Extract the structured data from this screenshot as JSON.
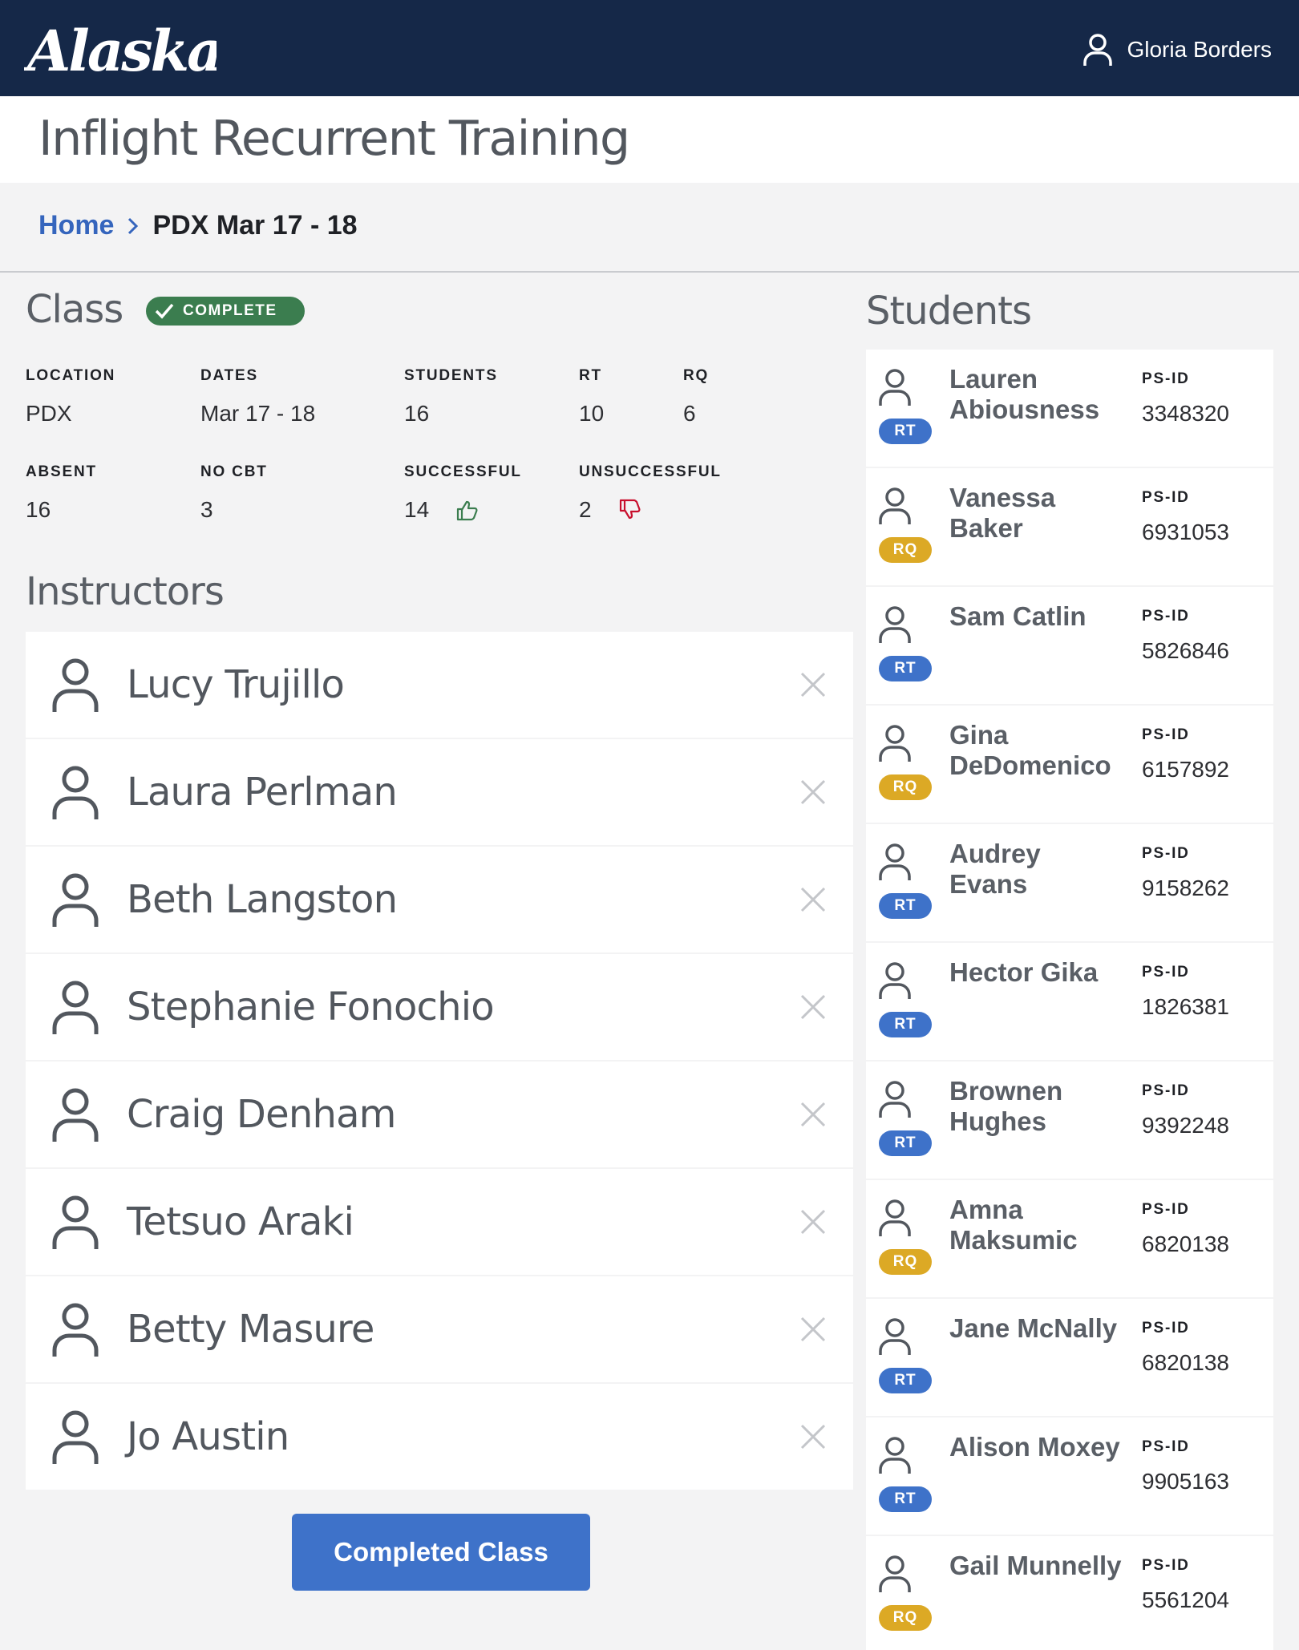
{
  "header": {
    "logo_text": "Alaska",
    "user_name": "Gloria Borders",
    "user_icon": "user-icon"
  },
  "page": {
    "title": "Inflight Recurrent Training"
  },
  "breadcrumb": {
    "home": "Home",
    "separator_icon": "chevron-right-icon",
    "current": "PDX Mar 17 - 18"
  },
  "class": {
    "title": "Class",
    "status": "COMPLETE",
    "status_color": "#3b7d4f",
    "stats": [
      {
        "label": "LOCATION",
        "value": "PDX"
      },
      {
        "label": "DATES",
        "value": "Mar 17 - 18"
      },
      {
        "label": "STUDENTS",
        "value": "16"
      },
      {
        "label": "RT",
        "value": "10"
      },
      {
        "label": "RQ",
        "value": "6"
      },
      {
        "label": "ABSENT",
        "value": "16"
      },
      {
        "label": "NO CBT",
        "value": "3"
      },
      {
        "label": "SUCCESSFUL",
        "value": "14",
        "icon": "thumbs-up-icon"
      },
      {
        "label": "UNSUCCESSFUL",
        "value": "2",
        "icon": "thumbs-down-icon"
      }
    ]
  },
  "instructors": {
    "title": "Instructors",
    "items": [
      {
        "name": "Lucy Trujillo"
      },
      {
        "name": "Laura Perlman"
      },
      {
        "name": "Beth Langston"
      },
      {
        "name": "Stephanie Fonochio"
      },
      {
        "name": "Craig Denham"
      },
      {
        "name": "Tetsuo Araki"
      },
      {
        "name": "Betty Masure"
      },
      {
        "name": "Jo Austin"
      }
    ]
  },
  "actions": {
    "completed_class_label": "Completed Class"
  },
  "students": {
    "title": "Students",
    "psid_label": "PS-ID",
    "items": [
      {
        "name": "Lauren Abiousness",
        "type": "RT",
        "psid": "3348320"
      },
      {
        "name": "Vanessa Baker",
        "type": "RQ",
        "psid": "6931053"
      },
      {
        "name": "Sam Catlin",
        "type": "RT",
        "psid": "5826846"
      },
      {
        "name": "Gina DeDomenico",
        "type": "RQ",
        "psid": "6157892"
      },
      {
        "name": "Audrey Evans",
        "type": "RT",
        "psid": "9158262"
      },
      {
        "name": "Hector Gika",
        "type": "RT",
        "psid": "1826381"
      },
      {
        "name": "Brownen Hughes",
        "type": "RT",
        "psid": "9392248"
      },
      {
        "name": "Amna Maksumic",
        "type": "RQ",
        "psid": "6820138"
      },
      {
        "name": "Jane McNally",
        "type": "RT",
        "psid": "6820138"
      },
      {
        "name": "Alison Moxey",
        "type": "RT",
        "psid": "9905163"
      },
      {
        "name": "Gail Munnelly",
        "type": "RQ",
        "psid": "5561204"
      }
    ]
  },
  "colors": {
    "header_bg": "#152848",
    "link": "#3565bd",
    "primary_button": "#3e72c9",
    "rt_badge": "#3e72c9",
    "rq_badge": "#dca925",
    "success": "#3b7d4f",
    "failure": "#c8102e"
  }
}
